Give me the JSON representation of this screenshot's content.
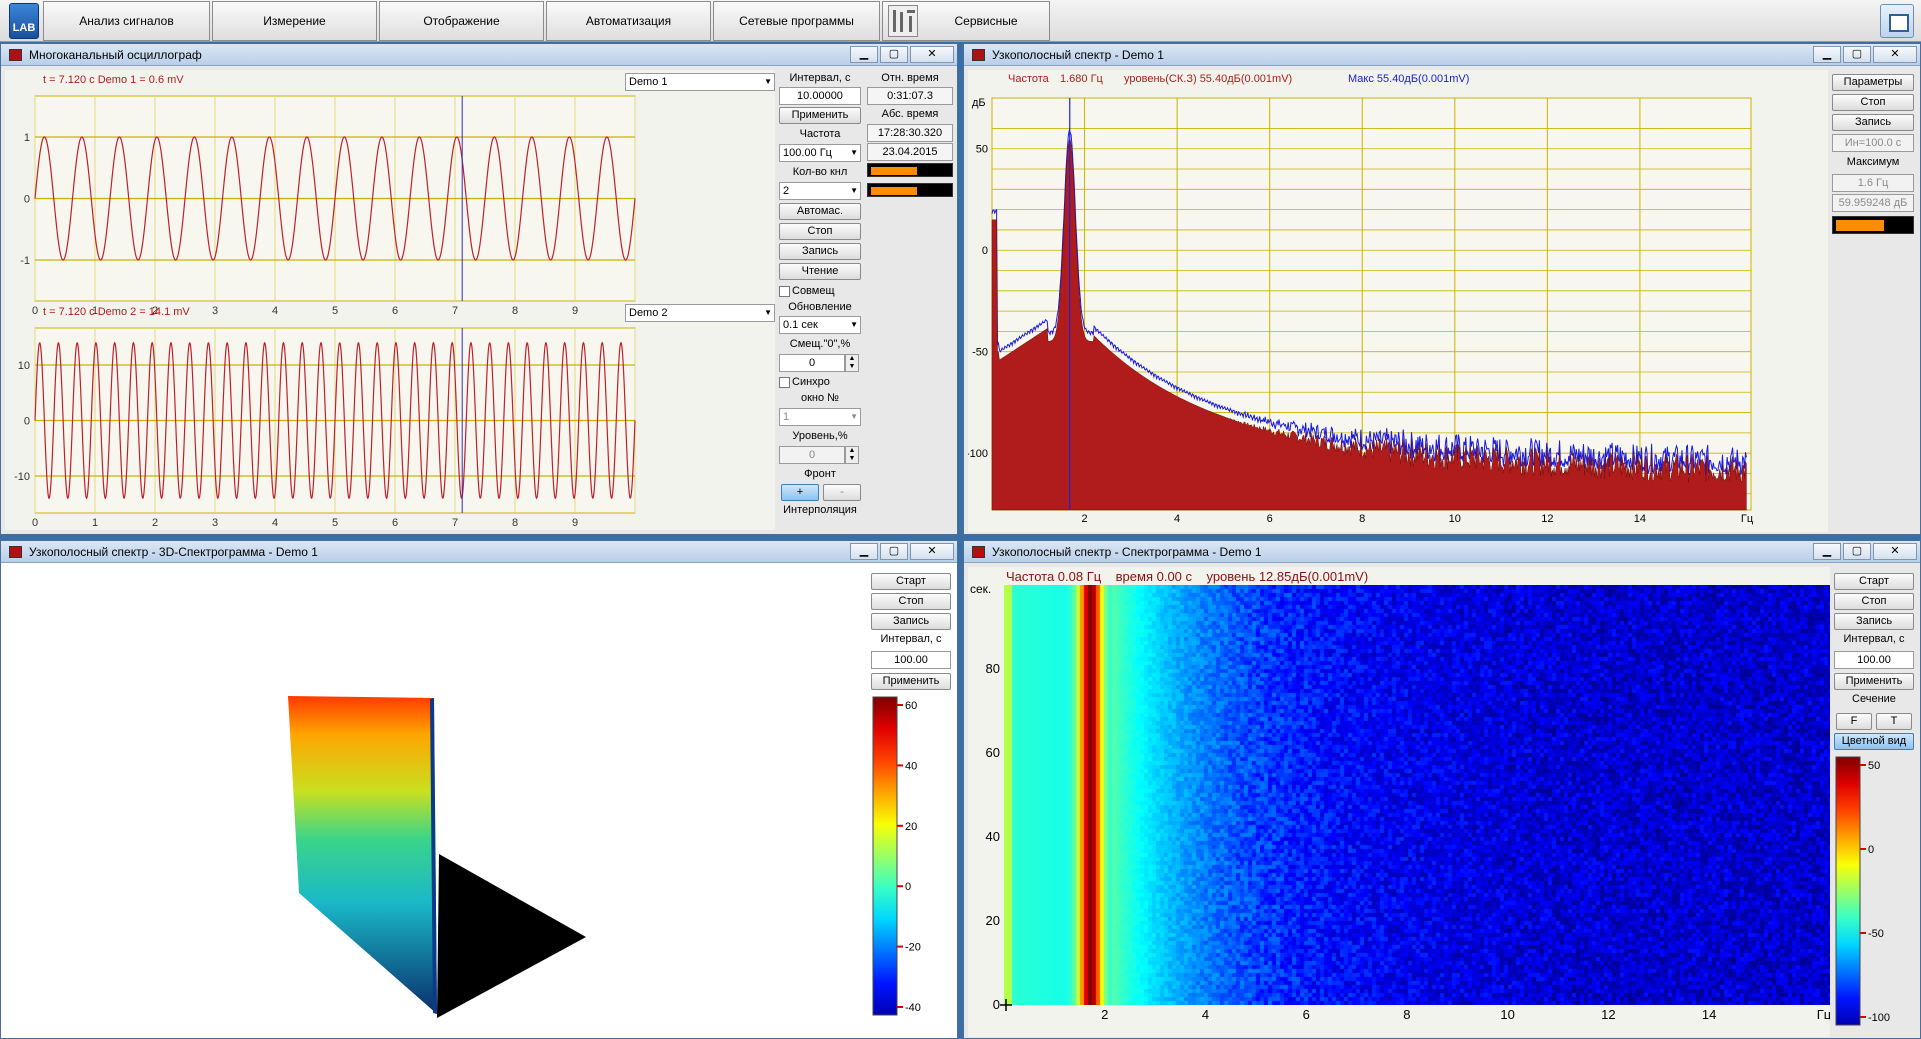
{
  "logo": "LAB",
  "menu": [
    "Анализ сигналов",
    "Измерение",
    "Отображение",
    "Автоматизация",
    "Сетевые программы",
    "Сервисные"
  ],
  "win1": {
    "title": "Многоканальный осциллограф",
    "ch1_readout": "t = 7.120 с  Demo 1 =   0.6 mV",
    "ch1_select": "Demo 1",
    "ch2_readout": "t = 7.120 с  Demo 2 =  14.1 mV",
    "ch2_select": "Demo 2",
    "ch1_yticks": [
      "1",
      "0",
      "-1"
    ],
    "ch2_yticks": [
      "10",
      "0",
      "-10"
    ],
    "xticks": [
      "0",
      "1",
      "2",
      "3",
      "4",
      "5",
      "6",
      "7",
      "8",
      "9"
    ],
    "cursor_t": 7.12,
    "ctrl": {
      "interval_label": "Интервал, с",
      "interval_value": "10.00000",
      "rel_time_label": "Отн. время",
      "rel_time": "0:31:07.3",
      "apply": "Применить",
      "abs_time_label": "Абс. время",
      "abs_time": "17:28:30.320",
      "freq_label": "Частота",
      "freq_value": "100.00 Гц",
      "date": "23.04.2015",
      "channels_label": "Кол-во кнл",
      "channels_value": "2",
      "autoscale": "Автомас.",
      "stop": "Стоп",
      "record": "Запись",
      "read": "Чтение",
      "combine": "Совмещ",
      "update_label": "Обновление",
      "update_value": "0.1 сек",
      "offset_label": "Смещ.\"0\",%",
      "offset_value": "0",
      "sync": "Синхро",
      "window_label": "окно №",
      "window_value": "1",
      "level_label": "Уровень,%",
      "level_value": "0",
      "front_label": "Фронт",
      "front_plus": "+",
      "front_minus": "-",
      "interp": "Интерполяция"
    }
  },
  "win2": {
    "title": "Узкополосный спектр - Demo 1",
    "freq_label": "Частота",
    "freq_value": "1.680 Гц",
    "level_text": "уровень(СК.З)  55.40дБ(0.001mV)",
    "max_text": "Макс  55.40дБ(0.001mV)",
    "y_unit": "дБ",
    "x_unit": "Гц",
    "yticks": [
      "50",
      "0",
      "-50",
      "-100"
    ],
    "xticks": [
      "2",
      "4",
      "6",
      "8",
      "10",
      "12",
      "14"
    ],
    "cursor_f": 1.68,
    "ctrl": {
      "params": "Параметры",
      "stop": "Стоп",
      "record": "Запись",
      "avg": "Ин=100.0 с",
      "max_label": "Максимум",
      "max_freq": "1.6 Гц",
      "max_db": "59.959248  дБ"
    }
  },
  "win3": {
    "title": "Узкополосный спектр - 3D-Спектрограмма - Demo 1",
    "start": "Старт",
    "stop": "Стоп",
    "record": "Запись",
    "interval_label": "Интервал, с",
    "interval_value": "100.00",
    "apply": "Применить",
    "scale": [
      "60",
      "40",
      "20",
      "0",
      "-20",
      "-40"
    ]
  },
  "win4": {
    "title": "Узкополосный спектр - Спектрограмма - Demo 1",
    "status": "Частота 0.08 Гц    время 0.00 с    уровень 12.85дБ(0.001mV)",
    "y_unit": "сек.",
    "x_unit": "Гц",
    "yticks": [
      "80",
      "60",
      "40",
      "20",
      "0"
    ],
    "xticks": [
      "2",
      "4",
      "6",
      "8",
      "10",
      "12",
      "14"
    ],
    "ctrl": {
      "start": "Старт",
      "stop": "Стоп",
      "record": "Запись",
      "interval_label": "Интервал, с",
      "interval_value": "100.00",
      "apply": "Применить",
      "section_label": "Сечение",
      "f": "F",
      "t": "T",
      "color_view": "Цветной вид"
    },
    "scale": [
      "50",
      "0",
      "-50",
      "-100"
    ]
  },
  "colors": {
    "signal": "#c0202a",
    "grid": "#c8b400",
    "spectrum": "#b01c1c",
    "max_line": "#1a1ae0"
  }
}
